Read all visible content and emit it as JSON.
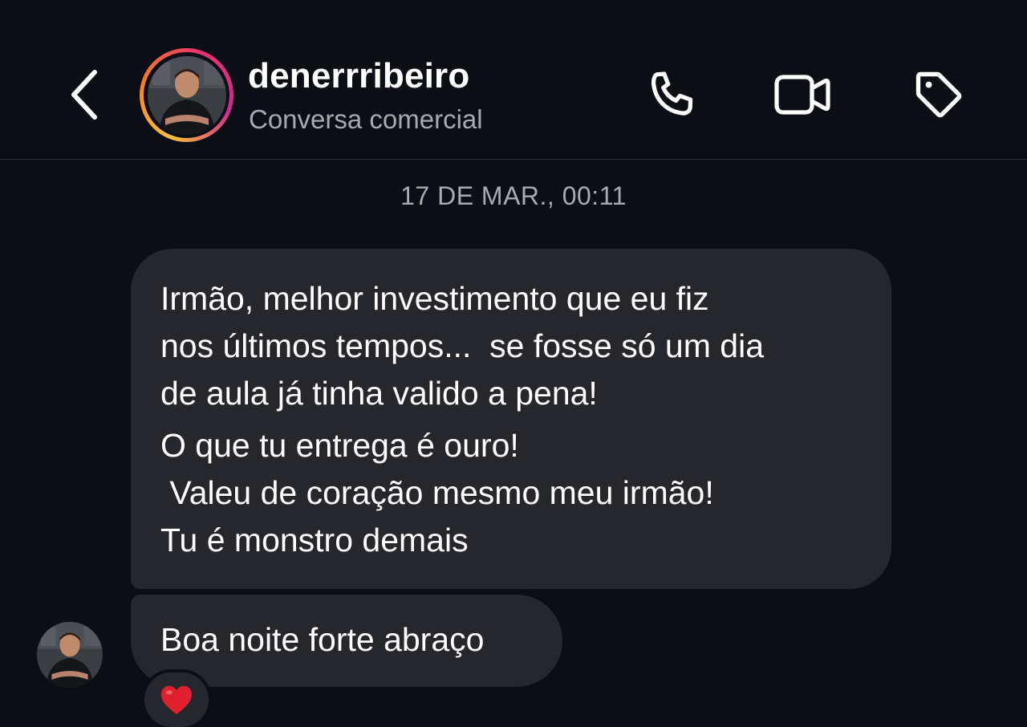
{
  "header": {
    "username": "denerrribeiro",
    "subtitle": "Conversa comercial"
  },
  "icons": {
    "back": "chevron-left-icon",
    "phone": "phone-icon",
    "video": "video-camera-icon",
    "tag": "tag-icon",
    "reaction": "heart-icon"
  },
  "colors": {
    "background": "#0c0e15",
    "bubble": "#25272d",
    "story_ring": [
      "#f9c13a",
      "#e8326e",
      "#d0288f"
    ],
    "reaction_heart": "#e0202e"
  },
  "thread": {
    "timestamp": "17 DE MAR., 00:11",
    "messages": [
      {
        "lines": [
          "Irmão, melhor investimento que eu fiz",
          "nos últimos tempos...  se fosse só um dia",
          "de aula já tinha valido a pena!",
          "O que tu entrega é ouro!",
          " Valeu de coração mesmo meu irmão!",
          "Tu é monstro demais"
        ]
      },
      {
        "text": "Boa noite forte abraço",
        "reaction": "❤️"
      }
    ]
  }
}
